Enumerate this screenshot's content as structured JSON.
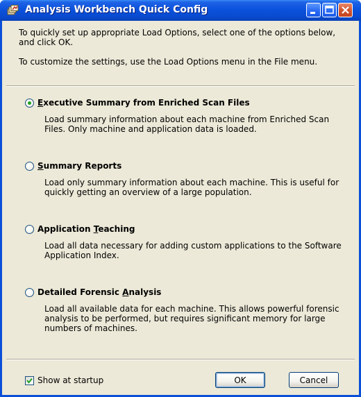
{
  "window": {
    "title": "Analysis Workbench Quick Config"
  },
  "intro": {
    "line1": "To quickly set up appropriate Load Options, select one of the options below, and click OK.",
    "line2": "To customize the settings, use the Load Options menu in the File menu."
  },
  "options": [
    {
      "pre": "",
      "accel": "E",
      "post": "xecutive Summary from Enriched Scan Files",
      "description": "Load summary information about each machine from Enriched Scan Files. Only machine and application data is loaded.",
      "selected": true
    },
    {
      "pre": "",
      "accel": "S",
      "post": "ummary Reports",
      "description": "Load only summary information about each machine.  This is useful for quickly getting an overview of a large population.",
      "selected": false
    },
    {
      "pre": "Application ",
      "accel": "T",
      "post": "eaching",
      "description": "Load all data necessary for adding custom applications to the Software Application Index.",
      "selected": false
    },
    {
      "pre": "Detailed Forensic ",
      "accel": "A",
      "post": "nalysis",
      "description": "Load all available data for each machine.  This allows powerful forensic analysis to be performed, but requires significant memory for large numbers of machines.",
      "selected": false
    }
  ],
  "footer": {
    "show_at_startup": {
      "label": "Show at startup",
      "checked": true
    },
    "ok_label": "OK",
    "cancel_label": "Cancel"
  }
}
